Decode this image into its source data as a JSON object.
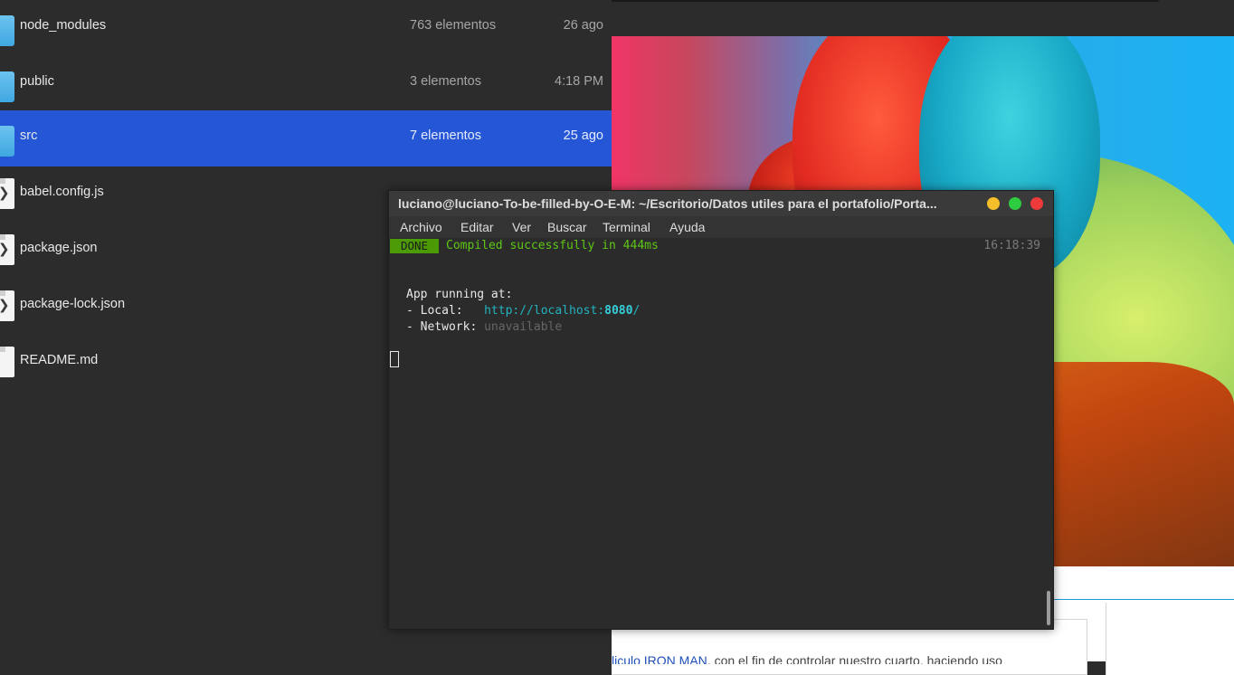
{
  "file_manager": {
    "items": [
      {
        "name": "node_modules",
        "count": "763 elementos",
        "date": "26 ago",
        "type": "folder-icon"
      },
      {
        "name": "public",
        "count": "3 elementos",
        "date": "4:18 PM",
        "type": "folder-icon"
      },
      {
        "name": "src",
        "count": "7 elementos",
        "date": "25 ago",
        "type": "folder-icon",
        "selected": true
      },
      {
        "name": "babel.config.js",
        "count": "",
        "date": "",
        "type": "code-file-icon"
      },
      {
        "name": "package.json",
        "count": "",
        "date": "",
        "type": "code-file-icon"
      },
      {
        "name": "package-lock.json",
        "count": "",
        "date": "",
        "type": "code-file-icon"
      },
      {
        "name": "README.md",
        "count": "",
        "date": "",
        "type": "text-file-icon"
      }
    ],
    "selection_color": "#2456d6"
  },
  "terminal": {
    "title": "luciano@luciano-To-be-filled-by-O-E-M: ~/Escritorio/Datos utiles para el portafolio/Porta...",
    "menu": [
      "Archivo",
      "Editar",
      "Ver",
      "Buscar",
      "Terminal",
      "Ayuda"
    ],
    "done_badge": "DONE",
    "compiled_msg": "Compiled successfully in 444ms",
    "timestamp": "16:18:39",
    "running_line": "App running at:",
    "local_label": "- Local:   ",
    "local_url_prefix": "http://localhost:",
    "local_port": "8080",
    "local_url_suffix": "/",
    "network_label": "- Network: ",
    "network_value": "unavailable",
    "colors": {
      "done_bg": "#4c9a06",
      "success": "#5fc716",
      "url": "#22b3bf"
    }
  },
  "background_page": {
    "text_prefix": "",
    "link_text": "liculo IRON MAN",
    "text_suffix": ", con el fin de controlar nuestro cuarto, haciendo uso"
  }
}
